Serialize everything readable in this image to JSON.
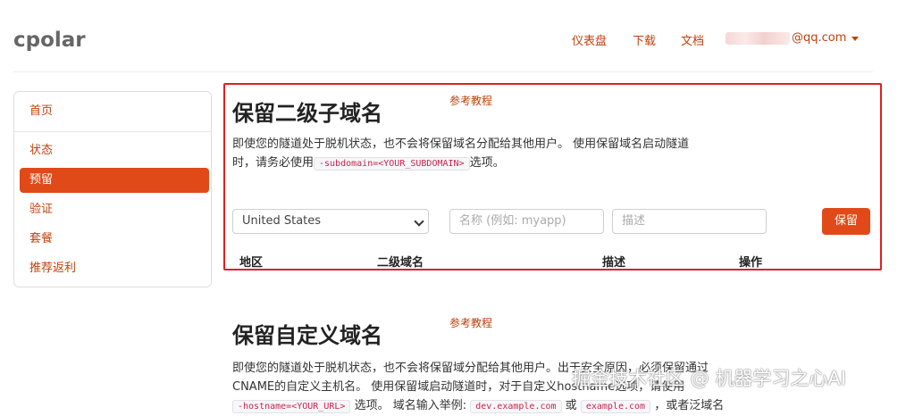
{
  "header": {
    "logo": "cpolar",
    "nav": [
      "仪表盘",
      "下载",
      "文档"
    ],
    "user_email": "@qq.com"
  },
  "sidebar": {
    "items": [
      {
        "label": "首页",
        "active": false
      },
      {
        "label": "状态",
        "active": false
      },
      {
        "label": "预留",
        "active": true
      },
      {
        "label": "验证",
        "active": false
      },
      {
        "label": "套餐",
        "active": false
      },
      {
        "label": "推荐返利",
        "active": false
      }
    ]
  },
  "reserve_subdomain": {
    "title": "保留二级子域名",
    "reference_link": "参考教程",
    "desc_line1": "即使您的隧道处于脱机状态，也不会将保留域名分配给其他用户。 使用保留域名启动隧道",
    "desc_line2_prefix": "时，请务必使用",
    "desc_code": "-subdomain=<YOUR_SUBDOMAIN>",
    "desc_line2_suffix": "选项。",
    "region_selected": "United States",
    "name_placeholder": "名称 (例如: myapp)",
    "desc_placeholder": "描述",
    "reserve_button": "保留",
    "table_headers": [
      "地区",
      "二级域名",
      "描述",
      "操作"
    ]
  },
  "reserve_custom_domain": {
    "title": "保留自定义域名",
    "reference_link": "参考教程",
    "desc_line1": "即使您的隧道处于脱机状态，也不会将保留域分配给其他用户。出于安全原因，必须保留通过",
    "desc_line2": "CNAME的自定义主机名。 使用保留域启动隧道时，对于自定义hostname选项，请使用",
    "desc_line3_code1": "-hostname=<YOUR_URL>",
    "desc_line3_mid": "选项。 域名输入举例:",
    "desc_line3_code2": "dev.example.com",
    "desc_line3_or": "或",
    "desc_line3_code3": "example.com",
    "desc_line3_end": "，或者泛域名"
  },
  "watermark": "掘金技术社区 @ 机器学习之心AI"
}
